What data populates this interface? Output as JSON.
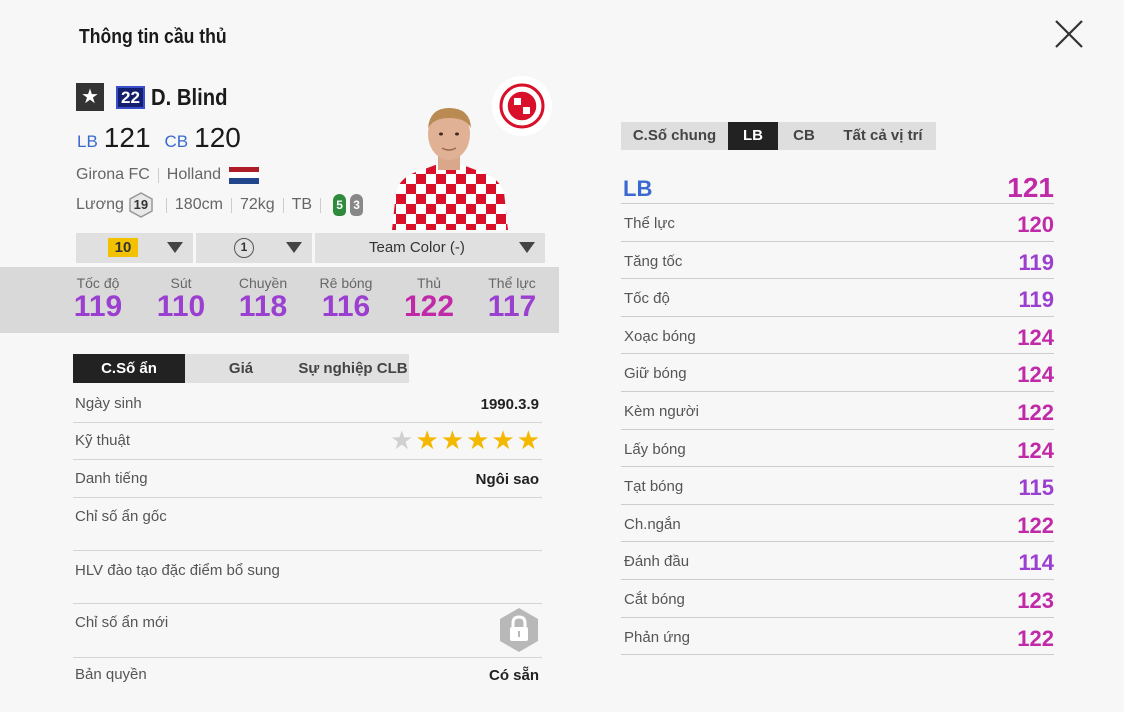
{
  "title": "Thông tin cầu thủ",
  "close_icon": "close-icon",
  "player": {
    "star_icon": "★",
    "number": "22",
    "name": "D. Blind",
    "positions": [
      {
        "pos": "LB",
        "ovr": "121"
      },
      {
        "pos": "CB",
        "ovr": "120"
      }
    ],
    "club": "Girona FC",
    "nation": "Holland",
    "wage_label": "Lương",
    "wage": "19",
    "height": "180cm",
    "weight": "72kg",
    "body": "TB",
    "left_foot": "5",
    "right_foot": "3"
  },
  "dropdowns": {
    "upgrade_level": "10",
    "skill_level": "1",
    "team_color": "Team Color (-)"
  },
  "main_stats": [
    {
      "label": "Tốc độ",
      "value": "119",
      "color": "#9b3fd0"
    },
    {
      "label": "Sút",
      "value": "110",
      "color": "#9b3fd0"
    },
    {
      "label": "Chuyền",
      "value": "118",
      "color": "#9b3fd0"
    },
    {
      "label": "Rê bóng",
      "value": "116",
      "color": "#9b3fd0"
    },
    {
      "label": "Thủ",
      "value": "122",
      "color": "#c02aa8"
    },
    {
      "label": "Thể lực",
      "value": "117",
      "color": "#9b3fd0"
    }
  ],
  "left_tabs": [
    "C.Số ẩn",
    "Giá",
    "Sự nghiệp CLB"
  ],
  "hidden": {
    "birth_label": "Ngày sinh",
    "birth": "1990.3.9",
    "skill_label": "Kỹ thuật",
    "skill_stars": 5,
    "skill_max": 6,
    "fame_label": "Danh tiếng",
    "fame": "Ngôi sao",
    "base_traits_label": "Chỉ số ẩn gốc",
    "coach_traits_label": "HLV đào tạo đặc điểm bổ sung",
    "new_traits_label": "Chỉ số ẩn mới",
    "license_label": "Bản quyền",
    "license": "Có sẵn"
  },
  "right_tabs": [
    "C.Số chung",
    "LB",
    "CB",
    "Tất cả vị trí"
  ],
  "detail": {
    "position": "LB",
    "ovr": "121",
    "stats": [
      {
        "label": "Thể lực",
        "value": "120"
      },
      {
        "label": "Tăng tốc",
        "value": "119"
      },
      {
        "label": "Tốc độ",
        "value": "119"
      },
      {
        "label": "Xoạc bóng",
        "value": "124"
      },
      {
        "label": "Giữ bóng",
        "value": "124"
      },
      {
        "label": "Kèm người",
        "value": "122"
      },
      {
        "label": "Lấy bóng",
        "value": "124"
      },
      {
        "label": "Tạt bóng",
        "value": "115"
      },
      {
        "label": "Ch.ngắn",
        "value": "122"
      },
      {
        "label": "Đánh đầu",
        "value": "114"
      },
      {
        "label": "Cắt bóng",
        "value": "123"
      },
      {
        "label": "Phản ứng",
        "value": "122"
      }
    ]
  },
  "colors": {
    "stat_purple": "#9b3fd0",
    "stat_magenta": "#c02aa8",
    "position_blue": "#3a6ad0",
    "level_gold": "#f2c200",
    "star_gold": "#f5b800"
  }
}
